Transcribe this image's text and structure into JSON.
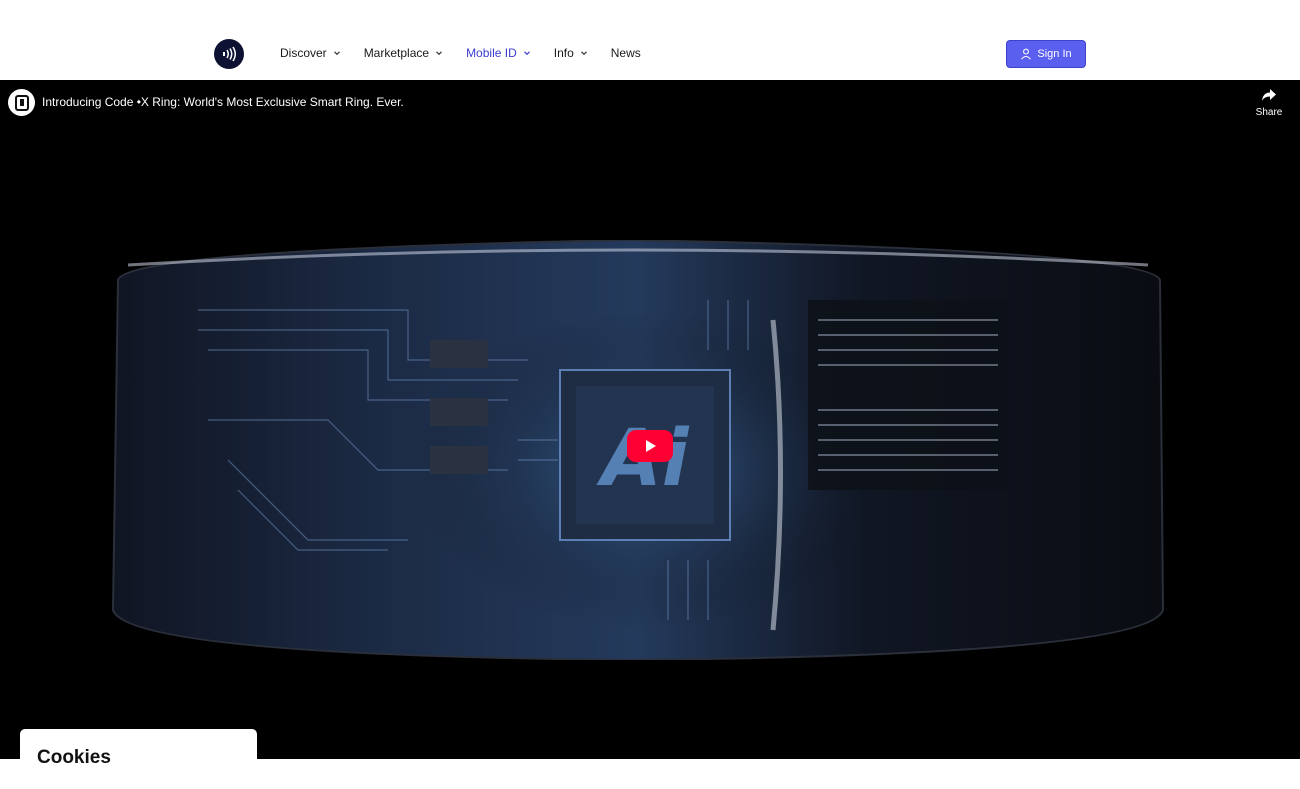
{
  "nav": {
    "items": [
      {
        "label": "Discover",
        "has_chevron": true,
        "active": false
      },
      {
        "label": "Marketplace",
        "has_chevron": true,
        "active": false
      },
      {
        "label": "Mobile ID",
        "has_chevron": true,
        "active": true
      },
      {
        "label": "Info",
        "has_chevron": true,
        "active": false
      },
      {
        "label": "News",
        "has_chevron": false,
        "active": false
      }
    ],
    "sign_in_label": "Sign In"
  },
  "video": {
    "title": "Introducing Code •X Ring: World's Most Exclusive Smart Ring. Ever.",
    "share_label": "Share",
    "chip_text": "Ai"
  },
  "cookies": {
    "title": "Cookies"
  },
  "colors": {
    "accent": "#5b5ff0",
    "active_nav": "#3b3ccf",
    "logo_bg": "#0d1233",
    "play_button": "#ff0033"
  },
  "icons": [
    "nfc-logo-icon",
    "chevron-down-icon",
    "user-icon",
    "share-icon",
    "play-icon",
    "channel-avatar-icon"
  ]
}
